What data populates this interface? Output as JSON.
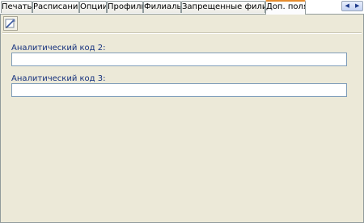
{
  "tabs": [
    {
      "label": "Печать"
    },
    {
      "label": "Расписание"
    },
    {
      "label": "Опции"
    },
    {
      "label": "Профили"
    },
    {
      "label": "Филиалы"
    },
    {
      "label": "Запрещенные филиалы"
    },
    {
      "label": "Доп. поля",
      "active": true
    }
  ],
  "tab_scroll": {
    "left_icon": "chevron-left-icon",
    "right_icon": "chevron-right-icon",
    "left_glyph": "◀",
    "right_glyph": "▶"
  },
  "toolbar": {
    "edit_icon": "edit-pencil-icon"
  },
  "fields": [
    {
      "label": "Аналитический код 2:",
      "value": ""
    },
    {
      "label": "Аналитический код 3:",
      "value": ""
    }
  ],
  "colors": {
    "panel_bg": "#ece9d8",
    "active_tab_accent": "#e68b2c",
    "label_text": "#15317e",
    "field_border": "#7f9db9"
  }
}
